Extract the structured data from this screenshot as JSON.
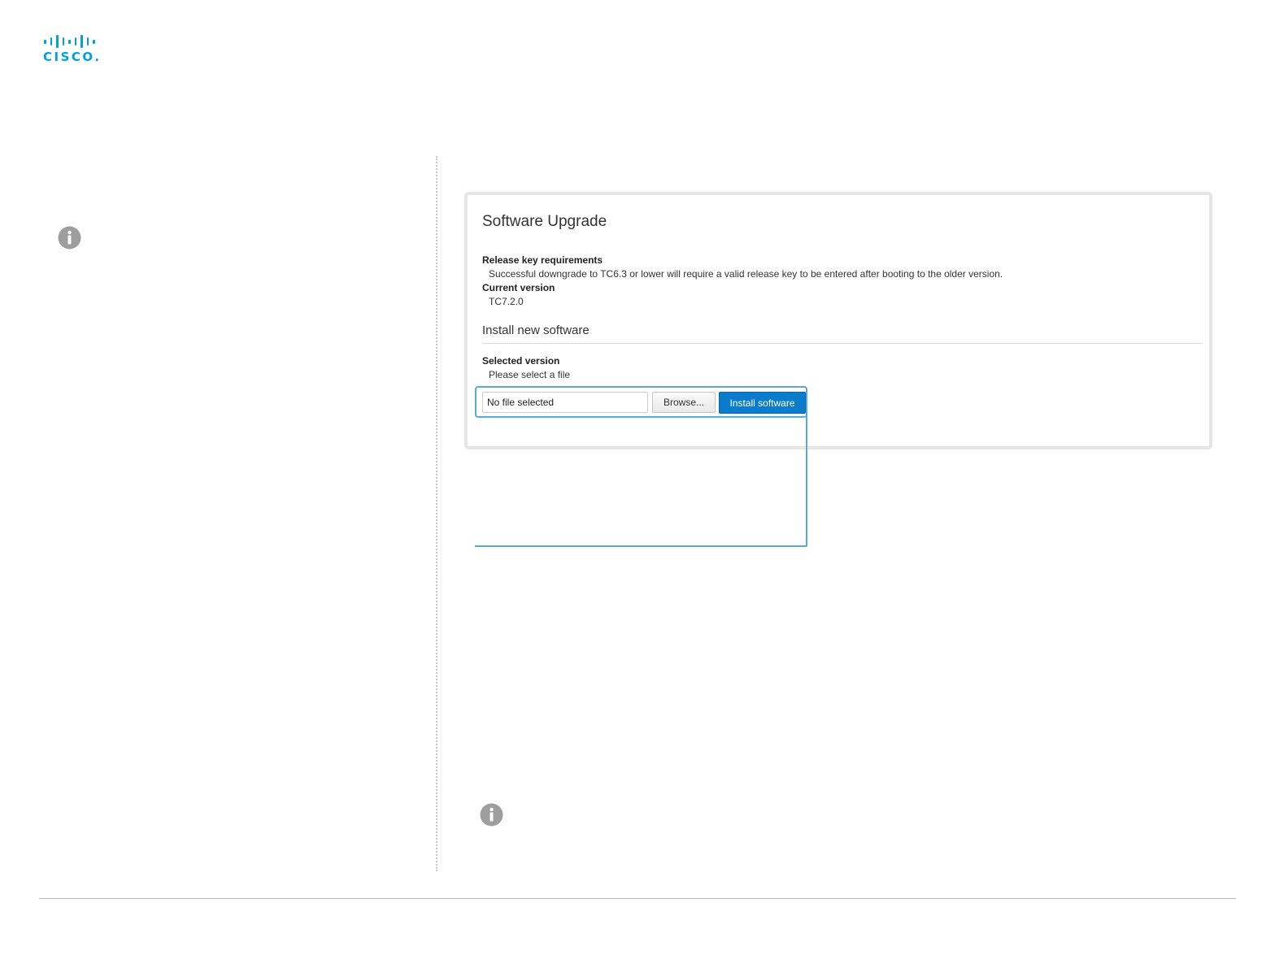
{
  "brand": {
    "logo_text": "CISCO.",
    "color": "#049fd9"
  },
  "icons": {
    "left_info": "info-icon",
    "bottom_info": "info-icon"
  },
  "panel": {
    "title": "Software Upgrade",
    "release_key_label": "Release key requirements",
    "release_key_text": "Successful downgrade to TC6.3 or lower will require a valid release key to be entered after booting to the older version.",
    "current_version_label": "Current version",
    "current_version_value": "TC7.2.0",
    "install_section_title": "Install new software",
    "selected_version_label": "Selected version",
    "selected_version_value": "Please select a file",
    "file_input_value": "No file selected",
    "browse_label": "Browse...",
    "install_label": "Install software"
  },
  "colors": {
    "accent": "#0a7ccc",
    "callout": "#5aa9d9",
    "info_icon": "#9e9e9e"
  }
}
